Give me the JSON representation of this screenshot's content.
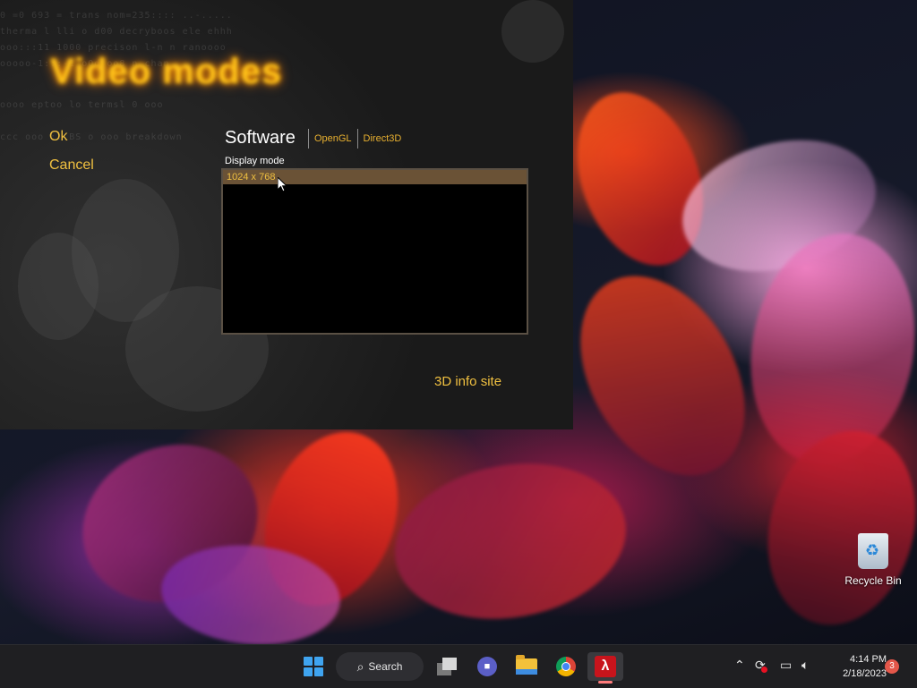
{
  "game": {
    "title": "Video modes",
    "ok_label": "Ok",
    "cancel_label": "Cancel",
    "renderers": {
      "software": "Software",
      "opengl": "OpenGL",
      "direct3d": "Direct3D"
    },
    "display_mode_label": "Display mode",
    "modes": [
      "1024 x 768"
    ],
    "selected_mode": "1024 x 768",
    "info_link": "3D info site"
  },
  "desktop": {
    "recycle_bin_label": "Recycle Bin"
  },
  "taskbar": {
    "search_label": "Search",
    "clock_time": "4:14 PM",
    "clock_date": "2/18/2023",
    "notification_count": "3",
    "icons": [
      "windows-start-icon",
      "search-icon",
      "task-view-icon",
      "meet-now-icon",
      "file-explorer-icon",
      "chrome-icon",
      "half-life-icon",
      "chevron-up-icon",
      "sync-icon",
      "network-icon",
      "volume-icon"
    ]
  },
  "colors": {
    "accent_gold": "#f0c040",
    "title_glow": "#ffc21a",
    "selected_row": "#6a5236",
    "taskbar_bg": "#1f1f22",
    "windows_blue": "#3fa4f0"
  }
}
